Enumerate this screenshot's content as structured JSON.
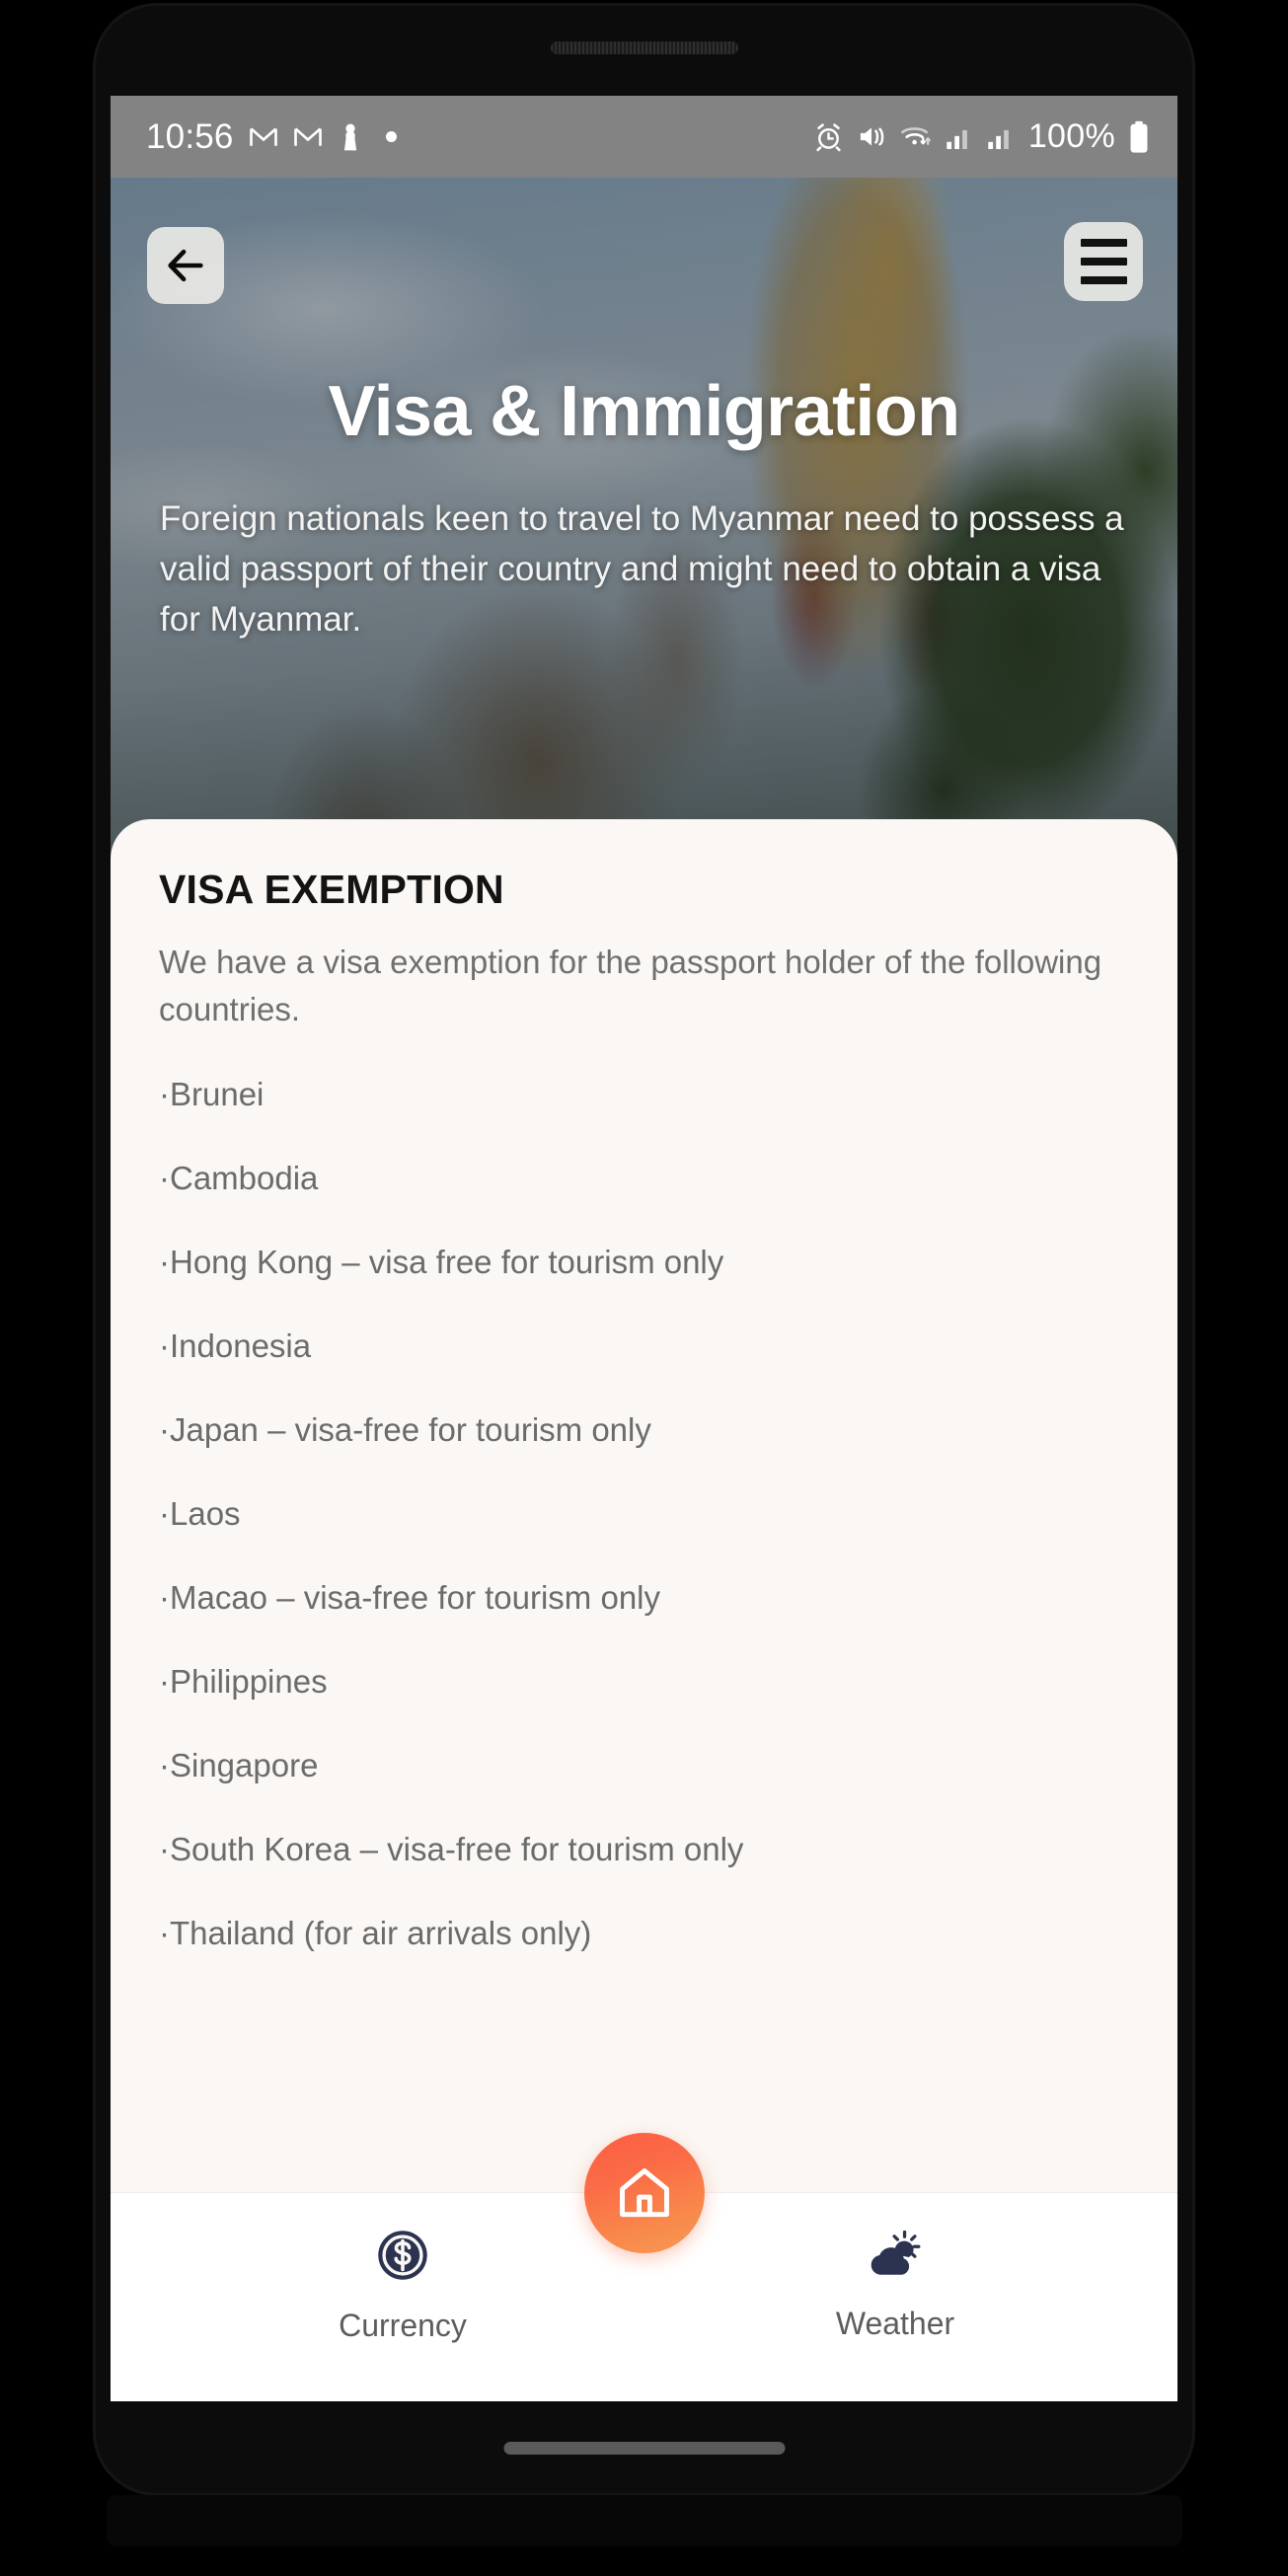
{
  "status_bar": {
    "time": "10:56",
    "battery_percent": "100%",
    "left_icons": [
      "gmail-icon",
      "gmail-icon",
      "chess-pawn-icon",
      "dot-indicator"
    ],
    "right_icons": [
      "alarm-icon",
      "mute-vibrate-icon",
      "wifi-icon",
      "signal-icon-1",
      "signal-icon-2",
      "battery-icon"
    ]
  },
  "header": {
    "back_label": "back-arrow",
    "menu_label": "menu",
    "title": "Visa & Immigration",
    "subtitle": "Foreign nationals keen to travel to Myanmar need to possess a valid passport of their country and might need to obtain a visa for Myanmar."
  },
  "card": {
    "title": "VISA EXEMPTION",
    "description": "We have a visa exemption for the passport holder of the following countries.",
    "countries": [
      "·Brunei",
      "·Cambodia",
      "·Hong Kong – visa free for tourism only",
      "·Indonesia",
      "·Japan – visa-free for tourism only",
      "·Laos",
      "·Macao – visa-free for tourism only",
      "·Philippines",
      "·Singapore",
      "·South Korea – visa-free for tourism only",
      "·Thailand (for air arrivals only)"
    ]
  },
  "bottom_nav": {
    "currency_label": "Currency",
    "weather_label": "Weather",
    "home_icon": "home-icon"
  },
  "colors": {
    "accent_orange": "#fb6b46",
    "nav_icon_navy": "#2c3350",
    "card_bg": "#faf7f4",
    "status_bar_bg": "#838383"
  }
}
